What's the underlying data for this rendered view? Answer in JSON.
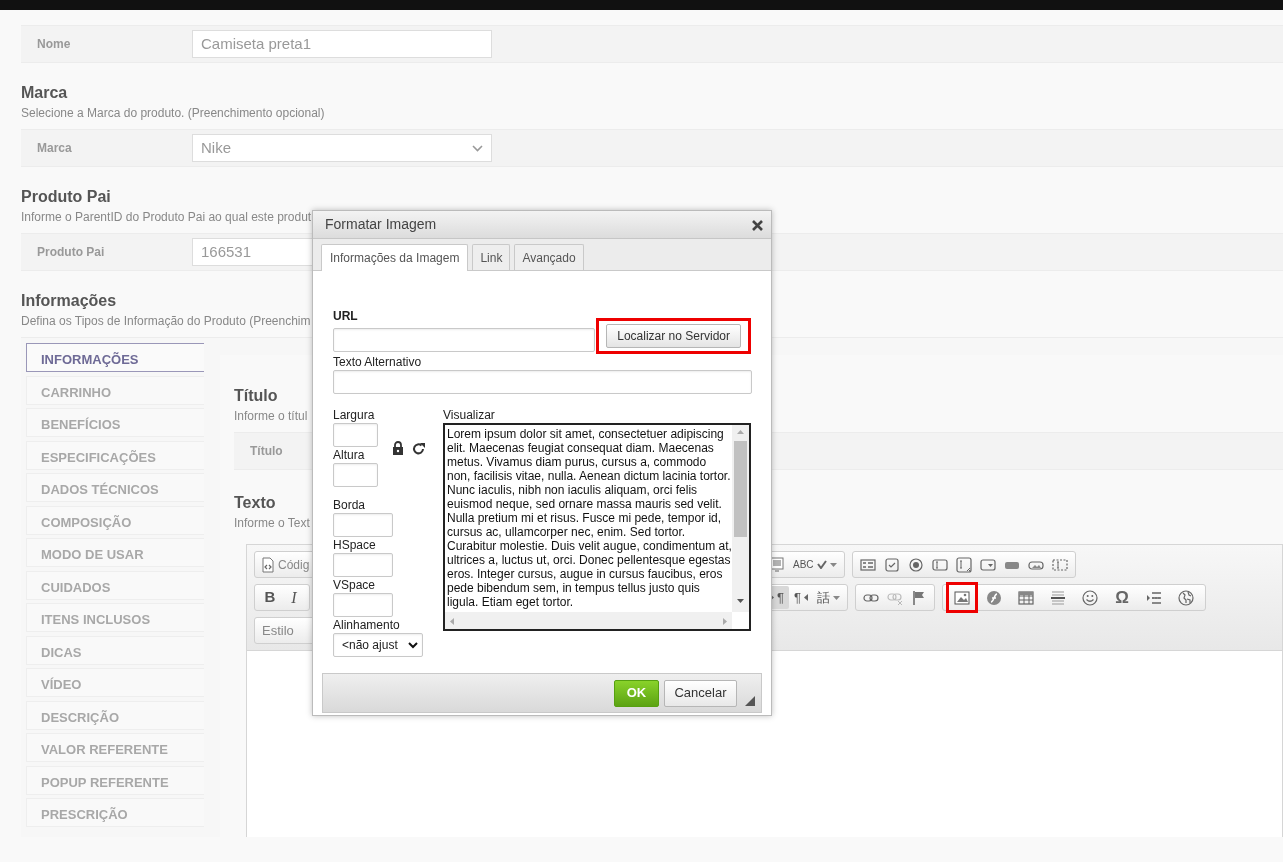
{
  "sections": [
    {
      "field": {
        "label": "Nome",
        "kind": "input",
        "value": "Camiseta preta1"
      }
    },
    {
      "title": "Marca",
      "description": "Selecione a Marca do produto. (Preenchimento opcional)",
      "field": {
        "label": "Marca",
        "kind": "select",
        "value": "Nike"
      }
    },
    {
      "title": "Produto Pai",
      "description": "Informe o ParentID do Produto Pai ao qual este produt",
      "field": {
        "label": "Produto Pai",
        "kind": "input",
        "value": "166531"
      }
    },
    {
      "title": "Informações",
      "description": "Defina os Tipos de Informação do Produto (Preenchim"
    }
  ],
  "info": {
    "tabs": [
      {
        "label": "INFORMAÇÕES",
        "selected": true
      },
      {
        "label": "CARRINHO",
        "selected": false
      },
      {
        "label": "BENEFÍCIOS",
        "selected": false
      },
      {
        "label": "ESPECIFICAÇÕES",
        "selected": false
      },
      {
        "label": "DADOS TÉCNICOS",
        "selected": false
      },
      {
        "label": "COMPOSIÇÃO",
        "selected": false
      },
      {
        "label": "MODO DE USAR",
        "selected": false
      },
      {
        "label": "CUIDADOS",
        "selected": false
      },
      {
        "label": "ITENS INCLUSOS",
        "selected": false
      },
      {
        "label": "DICAS",
        "selected": false
      },
      {
        "label": "VÍDEO",
        "selected": false
      },
      {
        "label": "DESCRIÇÃO",
        "selected": false
      },
      {
        "label": "VALOR REFERENTE",
        "selected": false
      },
      {
        "label": "POPUP REFERENTE",
        "selected": false
      },
      {
        "label": "PRESCRIÇÃO",
        "selected": false
      }
    ],
    "sections": [
      {
        "title": "Título",
        "description": "Informe o títul",
        "field": {
          "label": "Título"
        }
      },
      {
        "title": "Texto",
        "description": "Informe o Text"
      }
    ],
    "editor": {
      "rows": [
        {
          "start": [
            [
              {
                "kind": "source",
                "label": "Códig"
              }
            ]
          ],
          "end": [
            [
              {
                "kind": "template"
              },
              {
                "kind": "spellcheck",
                "label": "ABC"
              }
            ],
            [
              {
                "kind": "form"
              },
              {
                "kind": "checkbox"
              },
              {
                "kind": "radio"
              },
              {
                "kind": "textfield"
              },
              {
                "kind": "textarea"
              },
              {
                "kind": "select"
              },
              {
                "kind": "button"
              },
              {
                "kind": "imagebutton"
              },
              {
                "kind": "hiddenfield"
              }
            ]
          ]
        },
        {
          "start": [
            [
              {
                "kind": "bold",
                "label": "B"
              },
              {
                "kind": "italic",
                "label": "I"
              }
            ]
          ],
          "end": [
            [
              {
                "kind": "ltr",
                "label": "¶",
                "selected": true
              },
              {
                "kind": "rtl",
                "label": "¶",
                "selected": false
              },
              {
                "kind": "language",
                "label": "話"
              }
            ],
            [
              {
                "kind": "link",
                "disabled": false
              },
              {
                "kind": "unlink",
                "disabled": true
              },
              {
                "kind": "anchor",
                "disabled": false
              }
            ],
            [
              {
                "kind": "image",
                "highlighted": true
              },
              {
                "kind": "flash",
                "highlighted": false
              },
              {
                "kind": "table",
                "highlighted": false
              },
              {
                "kind": "hr",
                "highlighted": false
              },
              {
                "kind": "smiley",
                "highlighted": false
              },
              {
                "kind": "specialchar",
                "label": "Ω",
                "highlighted": false
              },
              {
                "kind": "pagebreak",
                "highlighted": false
              },
              {
                "kind": "iframe",
                "highlighted": false
              }
            ]
          ]
        },
        {
          "start": [
            [
              {
                "kind": "combo",
                "label": "Estilo"
              }
            ]
          ],
          "end": []
        }
      ]
    }
  },
  "dialog": {
    "title": "Formatar Imagem",
    "tabs": [
      {
        "label": "Informações da Imagem",
        "selected": true
      },
      {
        "label": "Link",
        "selected": false
      },
      {
        "label": "Avançado",
        "selected": false
      }
    ],
    "url_label": "URL",
    "browse_button": {
      "label": "Localizar no Servidor",
      "highlighted": true
    },
    "alt_label": "Texto Alternativo",
    "size_fields": [
      {
        "label": "Largura"
      },
      {
        "label": "Altura"
      }
    ],
    "spacing_fields": [
      {
        "label": "Borda"
      },
      {
        "label": "HSpace"
      },
      {
        "label": "VSpace"
      }
    ],
    "align": {
      "label": "Alinhamento",
      "value": "<não ajust"
    },
    "preview": {
      "label": "Visualizar",
      "text": "Lorem ipsum dolor sit amet, consectetuer adipiscing elit. Maecenas feugiat consequat diam. Maecenas metus. Vivamus diam purus, cursus a, commodo non, facilisis vitae, nulla. Aenean dictum lacinia tortor. Nunc iaculis, nibh non iaculis aliquam, orci felis euismod neque, sed ornare massa mauris sed velit. Nulla pretium mi et risus. Fusce mi pede, tempor id, cursus ac, ullamcorper nec, enim. Sed tortor. Curabitur molestie. Duis velit augue, condimentum at, ultrices a, luctus ut, orci. Donec pellentesque egestas eros. Integer cursus, augue in cursus faucibus, eros pede bibendum sem, in tempus tellus justo quis ligula. Etiam eget tortor."
    },
    "buttons": [
      {
        "label": "OK",
        "kind": "primary"
      },
      {
        "label": "Cancelar",
        "kind": "secondary"
      }
    ]
  }
}
